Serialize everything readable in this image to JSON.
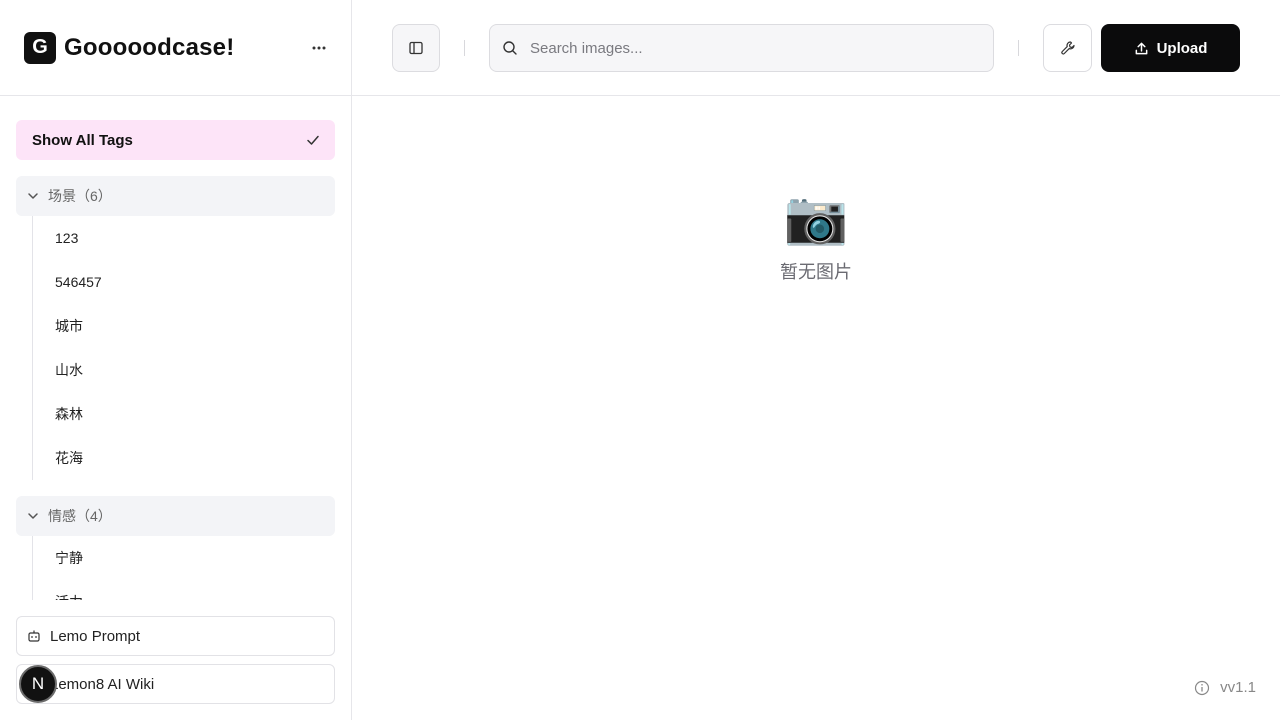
{
  "brand": {
    "logo_letter": "G",
    "name": "Gooooodcase!",
    "more_icon": "ellipsis-icon"
  },
  "tags": {
    "show_all_label": "Show All Tags",
    "groups": [
      {
        "title": "场景（6）",
        "items": [
          "123",
          "546457",
          "城市",
          "山水",
          "森林",
          "花海"
        ]
      },
      {
        "title": "情感（4）",
        "items": [
          "宁静",
          "活力"
        ]
      }
    ]
  },
  "footer": {
    "links": [
      {
        "label": "Lemo Prompt",
        "icon": "robot-icon"
      },
      {
        "label": "Lemon8 AI Wiki",
        "icon": "book-icon"
      }
    ],
    "avatar_letter": "N"
  },
  "topbar": {
    "search_placeholder": "Search images...",
    "upload_label": "Upload"
  },
  "main": {
    "empty_icon": "📷",
    "empty_text": "暂无图片",
    "version": "vv1.1"
  },
  "colors": {
    "accent_pink": "#fde4f8",
    "primary": "#0b0b0c"
  }
}
